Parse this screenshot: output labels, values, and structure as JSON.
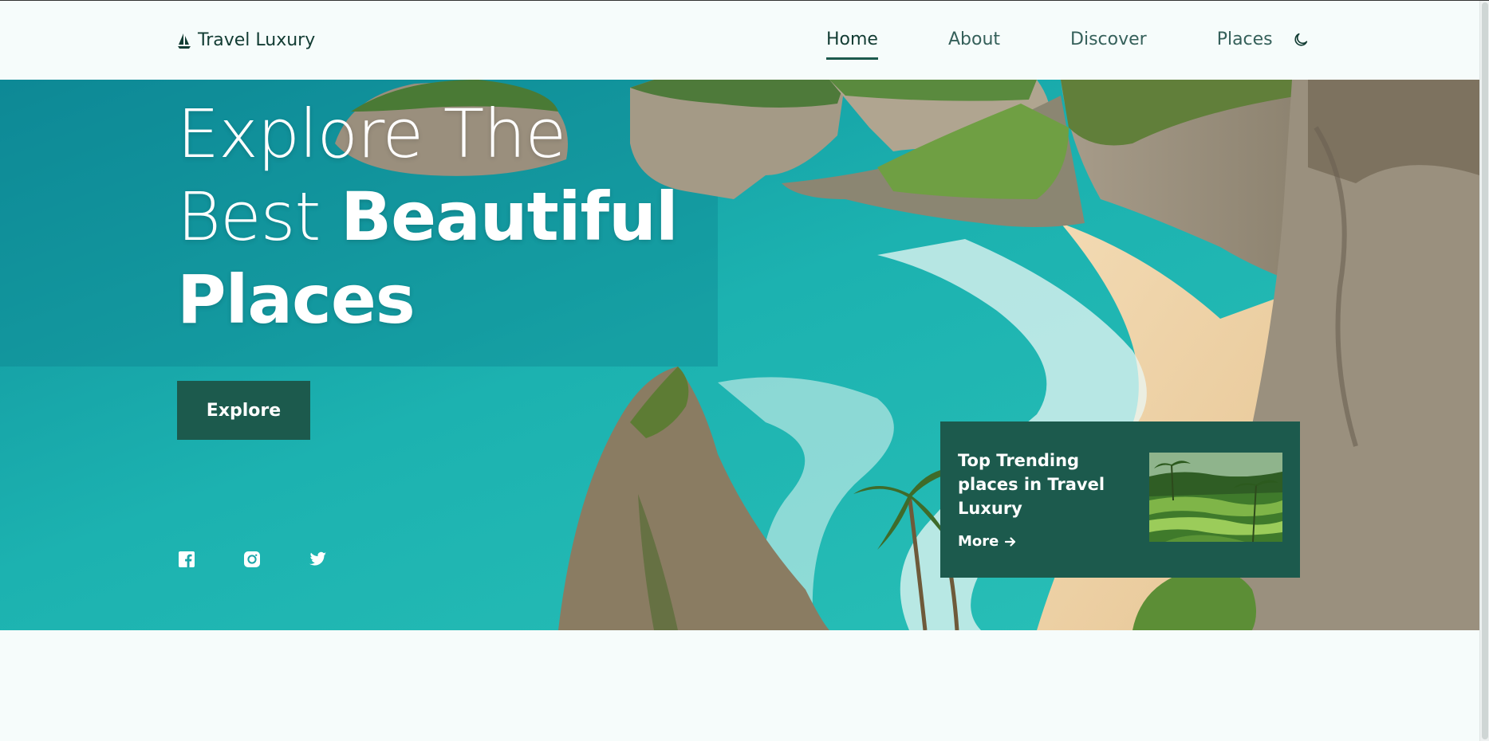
{
  "header": {
    "logo_text": "Travel Luxury",
    "nav": [
      {
        "label": "Home",
        "active": true
      },
      {
        "label": "About",
        "active": false
      },
      {
        "label": "Discover",
        "active": false
      },
      {
        "label": "Places",
        "active": false
      }
    ],
    "theme_toggle_icon": "moon-icon"
  },
  "hero": {
    "headline_line1": "Explore The",
    "headline_line2_light": "Best",
    "headline_line2_bold": "Beautiful",
    "headline_line3_bold": "Places",
    "explore_label": "Explore",
    "socials": [
      "facebook-icon",
      "instagram-icon",
      "twitter-icon"
    ]
  },
  "trending": {
    "title": "Top Trending places in Travel Luxury",
    "more_label": "More"
  },
  "colors": {
    "brand": "#1c5a4d",
    "text_dark": "#123c33",
    "background": "#f6fcfb"
  }
}
